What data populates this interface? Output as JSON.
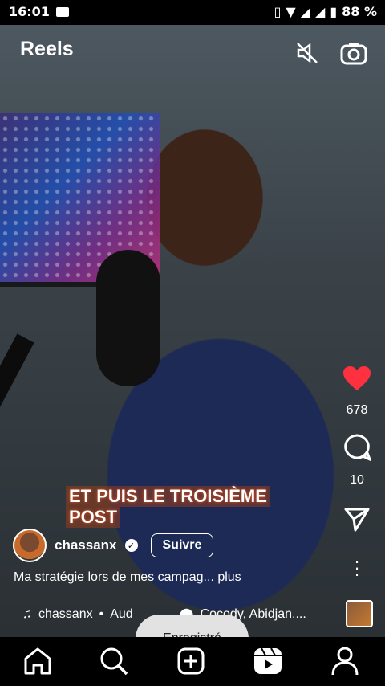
{
  "status_bar": {
    "time": "16:01",
    "battery": "88 %"
  },
  "header": {
    "title": "Reels"
  },
  "video": {
    "caption_line1": "ET PUIS LE TROISIÈME",
    "caption_line2": "POST"
  },
  "actions": {
    "likes": "678",
    "comments": "10"
  },
  "author": {
    "username": "chassanx",
    "follow_label": "Suivre"
  },
  "description": "Ma stratégie lors de mes campag... plus",
  "audio": {
    "artist": "chassanx",
    "separator": "•",
    "track": "Aud",
    "location": "Cocody, Abidjan,..."
  },
  "toast": "Enregistré"
}
